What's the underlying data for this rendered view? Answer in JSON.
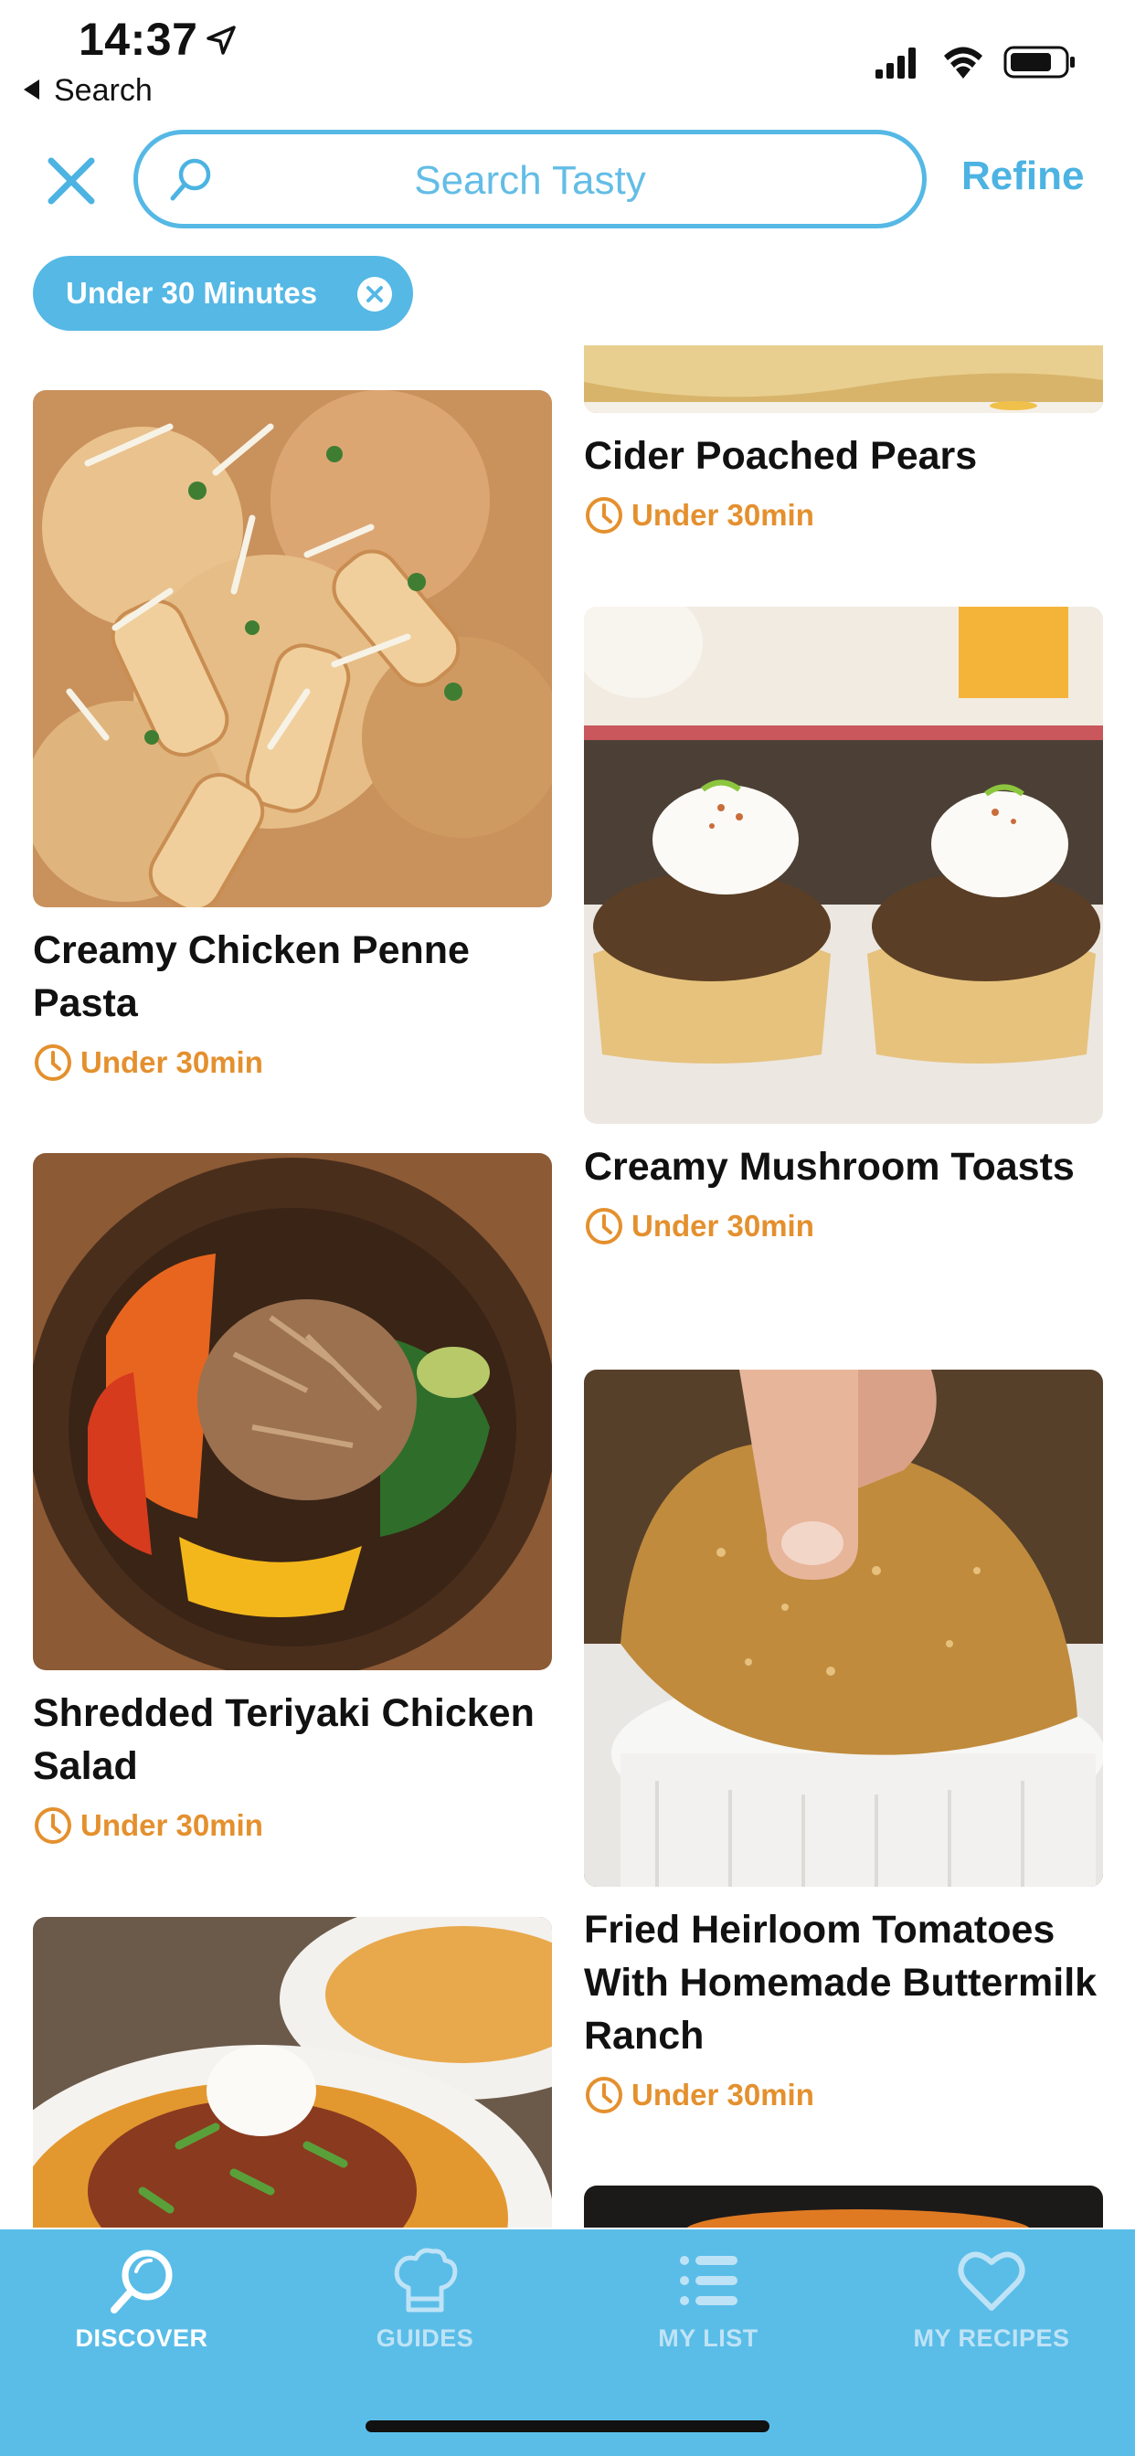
{
  "status_bar": {
    "time": "14:37",
    "back_label": "Search"
  },
  "search": {
    "placeholder": "Search Tasty",
    "refine_label": "Refine"
  },
  "filter_chip": {
    "label": "Under 30 Minutes"
  },
  "recipes": [
    {
      "title": "Cider Poached Pears",
      "time": "Under 30min"
    },
    {
      "title": "Creamy Chicken Penne Pasta",
      "time": "Under 30min"
    },
    {
      "title": "Creamy Mushroom Toasts",
      "time": "Under 30min"
    },
    {
      "title": "Shredded Teriyaki Chicken Salad",
      "time": "Under 30min"
    },
    {
      "title": "Fried Heirloom Tomatoes With Homemade Buttermilk Ranch",
      "time": "Under 30min"
    }
  ],
  "tabs": [
    {
      "label": "DISCOVER",
      "icon": "search-icon",
      "active": true
    },
    {
      "label": "GUIDES",
      "icon": "chef-hat-icon",
      "active": false
    },
    {
      "label": "MY LIST",
      "icon": "list-icon",
      "active": false
    },
    {
      "label": "MY RECIPES",
      "icon": "heart-icon",
      "active": false
    }
  ],
  "colors": {
    "accent": "#55b8e5",
    "tabbar": "#5abde8",
    "time_orange": "#e4902e"
  }
}
